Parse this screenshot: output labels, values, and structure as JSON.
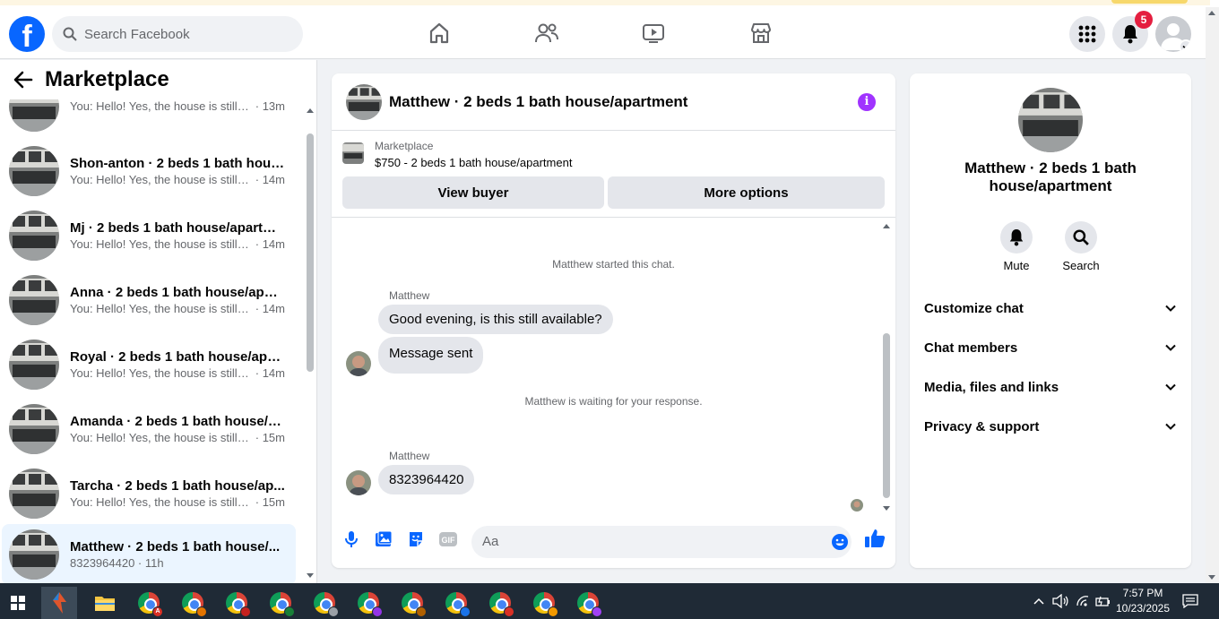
{
  "topbar": {
    "logo": "f",
    "search_placeholder": "Search Facebook",
    "notification_count": "5",
    "nav_icons": [
      "home-icon",
      "friends-icon",
      "watch-icon",
      "marketplace-icon"
    ],
    "brand_color": "#0866ff"
  },
  "sidebar": {
    "title": "Marketplace",
    "conversations": [
      {
        "name": "",
        "preview": "You: Hello! Yes, the house is still a...",
        "time": "13m"
      },
      {
        "name": "Shon-anton · 2 beds 1 bath hous...",
        "preview": "You: Hello! Yes, the house is still a...",
        "time": "14m"
      },
      {
        "name": "Mj · 2 beds 1 bath house/apartm...",
        "preview": "You: Hello! Yes, the house is still a...",
        "time": "14m"
      },
      {
        "name": "Anna · 2 beds 1 bath house/apar...",
        "preview": "You: Hello! Yes, the house is still a...",
        "time": "14m"
      },
      {
        "name": "Royal · 2 beds 1 bath house/apa...",
        "preview": "You: Hello! Yes, the house is still a...",
        "time": "14m"
      },
      {
        "name": "Amanda · 2 beds 1 bath house/a...",
        "preview": "You: Hello! Yes, the house is still a...",
        "time": "15m"
      },
      {
        "name": "Tarcha · 2 beds 1 bath house/ap...",
        "preview": "You: Hello! Yes, the house is still a...",
        "time": "15m"
      },
      {
        "name": "Matthew · 2 beds 1 bath house/...",
        "preview": "8323964420",
        "time": "11h"
      }
    ]
  },
  "chat": {
    "title": "Matthew · 2 beds 1 bath house/apartment",
    "listing_category": "Marketplace",
    "listing_price": "$750 - 2 beds 1 bath house/apartment",
    "view_buyer_label": "View buyer",
    "more_options_label": "More options",
    "started_text": "Matthew started this chat.",
    "sender_name": "Matthew",
    "message_1": "Good evening, is this still available?",
    "message_2": "Message sent",
    "waiting_text": "Matthew is waiting for your response.",
    "sender_name_2": "Matthew",
    "message_3": "8323964420",
    "input_placeholder": "Aa",
    "accent_color": "#0866ff"
  },
  "details": {
    "title": "Matthew · 2 beds 1 bath house/apartment",
    "mute_label": "Mute",
    "search_label": "Search",
    "sections": [
      "Customize chat",
      "Chat members",
      "Media, files and links",
      "Privacy & support"
    ]
  },
  "taskbar": {
    "time": "7:57 PM",
    "date": "10/23/2025",
    "chrome_profiles": [
      "A",
      "",
      "",
      "",
      "",
      "",
      "",
      "",
      "",
      "",
      ""
    ]
  }
}
